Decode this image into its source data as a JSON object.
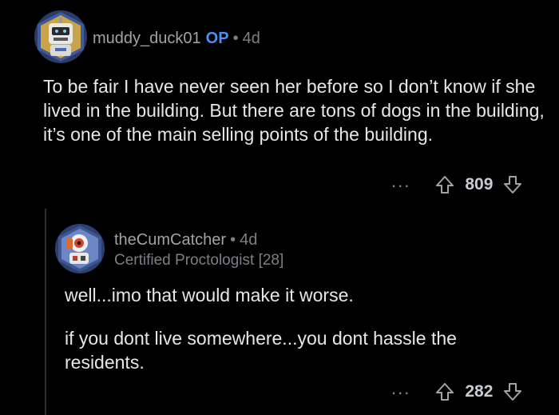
{
  "comment": {
    "author": "muddy_duck01",
    "op_tag": "OP",
    "separator": "•",
    "age": "4d",
    "body": "To be fair I have never seen her before so I don’t know if she lived in the building. But there are tons of dogs in the building, it’s one of the main selling points of the building.",
    "more": "...",
    "votes": "809"
  },
  "reply": {
    "author": "theCumCatcher",
    "separator": "•",
    "age": "4d",
    "flair": "Certified Proctologist [28]",
    "body_1": "well...imo that would make it worse.",
    "body_2": "if you dont live somewhere...you dont hassle the residents.",
    "more": "...",
    "votes": "282"
  },
  "icons": {
    "upvote": "upvote-arrow-icon",
    "downvote": "downvote-arrow-icon"
  }
}
